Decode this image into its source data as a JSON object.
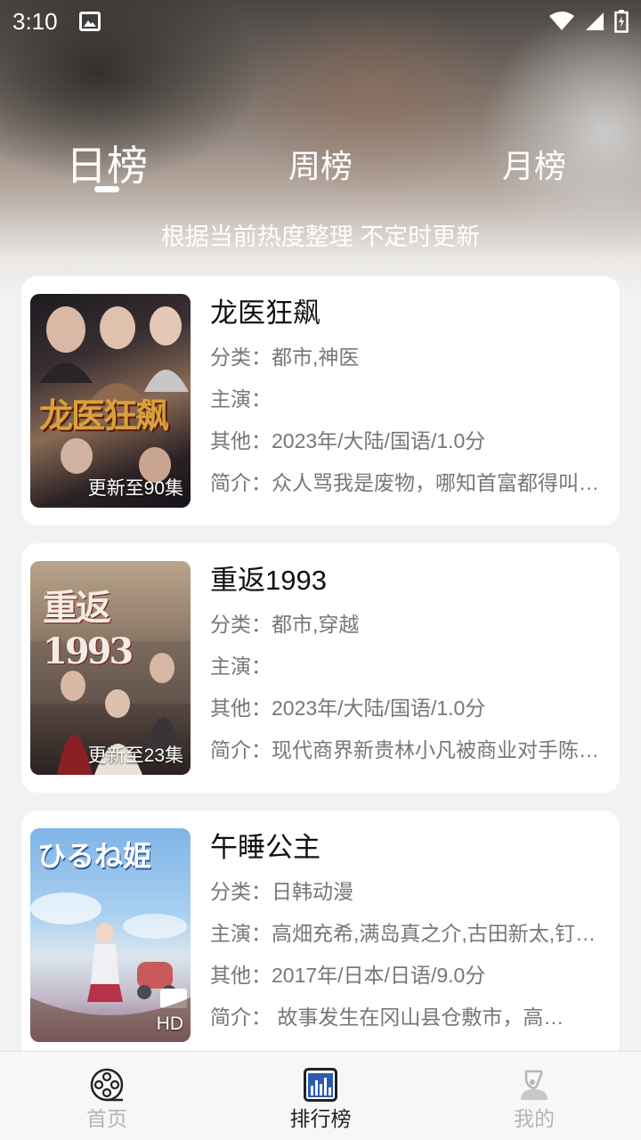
{
  "status_bar": {
    "time": "3:10",
    "icons": [
      "image-icon",
      "wifi-icon",
      "signal-icon",
      "battery-icon"
    ]
  },
  "tabs": {
    "day": "日榜",
    "week": "周榜",
    "month": "月榜",
    "active": "day"
  },
  "subtitle": "根据当前热度整理 不定时更新",
  "items": [
    {
      "title": "龙医狂飙",
      "badge": "更新至90集",
      "category": "分类：都市,神医",
      "cast": "主演：",
      "other": "其他：2023年/大陆/国语/1.0分",
      "intro": "简介：众人骂我是废物，哪知首富都得叫…",
      "poster_text": "龙医狂飙"
    },
    {
      "title": "重返1993",
      "badge": "更新至23集",
      "category": "分类：都市,穿越",
      "cast": "主演：",
      "other": "其他：2023年/大陆/国语/1.0分",
      "intro": "简介：现代商界新贵林小凡被商业对手陈…",
      "poster_text": "重返1993"
    },
    {
      "title": "午睡公主",
      "badge": "HD",
      "category": "分类：日韩动漫",
      "cast": "主演：高畑充希,满岛真之介,古田新太,钉…",
      "other": "其他：2017年/日本/日语/9.0分",
      "intro": "简介：      故事发生在冈山县仓敷市，高…",
      "poster_text": "ひるね姫"
    }
  ],
  "bottom_nav": {
    "home": "首页",
    "ranking": "排行榜",
    "mine": "我的",
    "active": "ranking"
  },
  "colors": {
    "active_nav_icon": "#2a5db0",
    "inactive_nav": "#b5b5b5"
  }
}
